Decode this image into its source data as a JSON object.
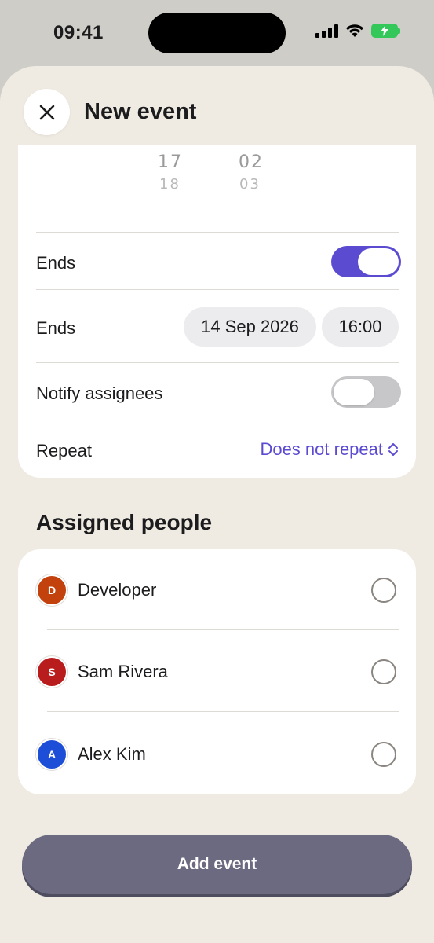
{
  "status_bar": {
    "time": "09:41"
  },
  "header": {
    "title": "New event",
    "close_icon": "close-icon"
  },
  "time_picker": {
    "hour_values": [
      "17",
      "18"
    ],
    "minute_values": [
      "02",
      "03"
    ]
  },
  "form": {
    "ends_toggle": {
      "label": "Ends",
      "on": true
    },
    "ends_datetime": {
      "label": "Ends",
      "date": "14 Sep 2026",
      "time": "16:00"
    },
    "notify_assignees": {
      "label": "Notify assignees",
      "on": false
    },
    "repeat": {
      "label": "Repeat",
      "value": "Does not repeat",
      "icon": "chevron-updown-icon"
    }
  },
  "assigned_people": {
    "title": "Assigned people",
    "people": [
      {
        "initial": "D",
        "name": "Developer",
        "color": "#c2410c",
        "selected": false
      },
      {
        "initial": "S",
        "name": "Sam Rivera",
        "color": "#b91c1c",
        "selected": false
      },
      {
        "initial": "A",
        "name": "Alex Kim",
        "color": "#1d4ed8",
        "selected": false
      }
    ]
  },
  "footer": {
    "add_button_label": "Add event"
  },
  "colors": {
    "accent": "#5b4bd1",
    "background": "#efebe2",
    "button": "#6b6a80"
  }
}
